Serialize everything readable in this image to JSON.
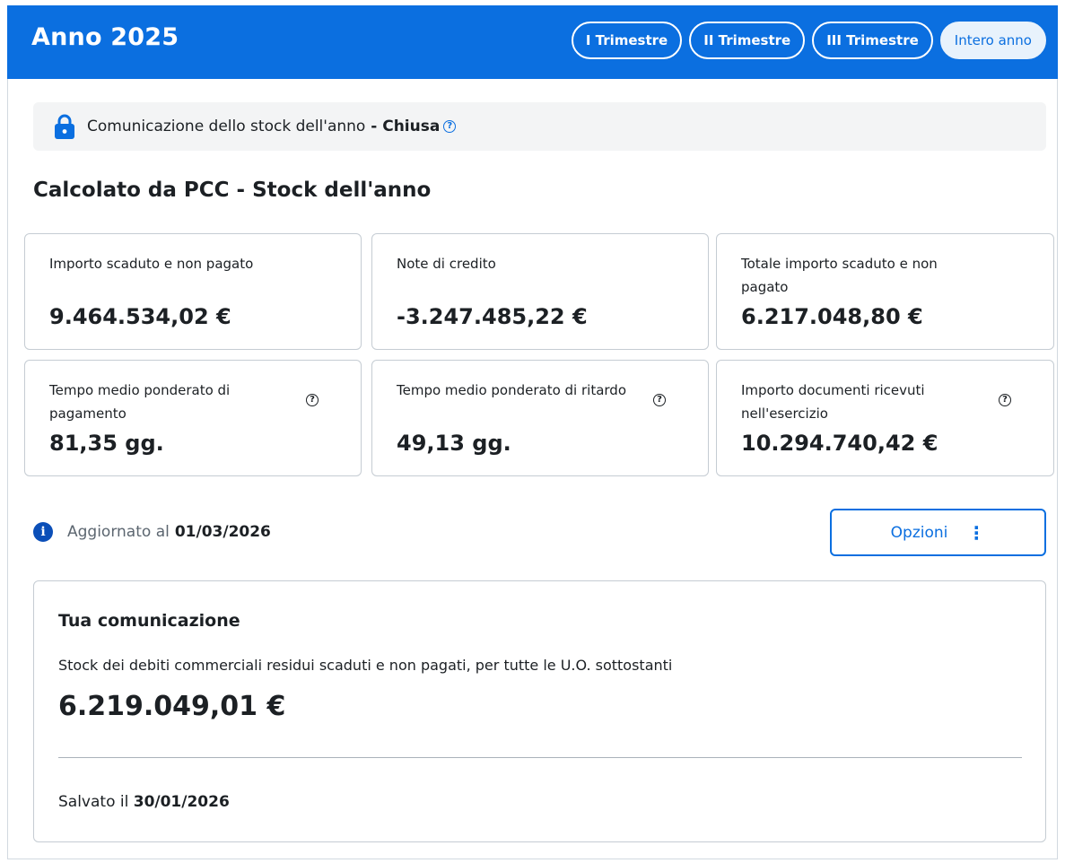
{
  "header": {
    "title": "Anno 2025",
    "tabs": [
      {
        "label": "I Trimestre",
        "active": false
      },
      {
        "label": "II Trimestre",
        "active": false
      },
      {
        "label": "III Trimestre",
        "active": false
      },
      {
        "label": "Intero anno",
        "active": true
      }
    ]
  },
  "notice": {
    "icon": "lock-icon",
    "text": "Comunicazione dello stock dell'anno",
    "separator": " - ",
    "status": "Chiusa"
  },
  "section_title": "Calcolato da PCC - Stock dell'anno",
  "cards": [
    {
      "label": "Importo scaduto e non pagato",
      "value": "9.464.534,02 €",
      "help": false
    },
    {
      "label": "Note di credito",
      "value": "-3.247.485,22 €",
      "help": false
    },
    {
      "label": "Totale importo scaduto e non pagato",
      "value": "6.217.048,80 €",
      "help": false
    },
    {
      "label": "Tempo medio ponderato di pagamento",
      "value": "81,35 gg.",
      "help": true
    },
    {
      "label": "Tempo medio ponderato di ritardo",
      "value": "49,13 gg.",
      "help": true
    },
    {
      "label": "Importo documenti ricevuti nell'esercizio",
      "value": "10.294.740,42 €",
      "help": true
    }
  ],
  "update_info": {
    "label": "Aggiornato al",
    "date": "01/03/2026"
  },
  "options_button": {
    "label": "Opzioni"
  },
  "communication": {
    "title": "Tua comunicazione",
    "description": "Stock dei debiti commerciali residui scaduti e non pagati, per tutte le U.O. sottostanti",
    "value": "6.219.049,01 €",
    "saved_label": "Salvato il",
    "saved_date": "30/01/2026"
  },
  "colors": {
    "primary": "#0b6fe0",
    "info_icon": "#0b4fb8",
    "card_border": "#c5ccd3",
    "notice_bg": "#f3f4f5"
  }
}
